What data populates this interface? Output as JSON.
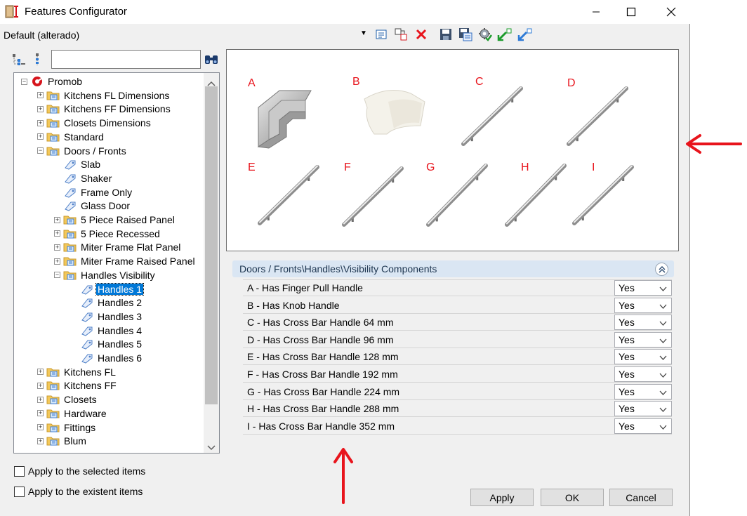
{
  "window": {
    "title": "Features Configurator"
  },
  "profile": {
    "selected": "Default (alterado)"
  },
  "toolbar": {
    "icons": [
      "properties-icon",
      "copy-icon",
      "delete-icon",
      "save-icon",
      "save-as-icon",
      "settings-icon",
      "import-icon",
      "export-icon"
    ]
  },
  "search": {
    "value": "",
    "placeholder": ""
  },
  "tree": {
    "items": [
      {
        "label": "Promob",
        "level": 0,
        "icon": "promob-logo-icon",
        "expander": "minus"
      },
      {
        "label": "Kitchens FL Dimensions",
        "level": 1,
        "icon": "folder-icon",
        "expander": "plus"
      },
      {
        "label": "Kitchens FF Dimensions",
        "level": 1,
        "icon": "folder-icon",
        "expander": "plus"
      },
      {
        "label": "Closets Dimensions",
        "level": 1,
        "icon": "folder-icon",
        "expander": "plus"
      },
      {
        "label": "Standard",
        "level": 1,
        "icon": "folder-icon",
        "expander": "plus"
      },
      {
        "label": "Doors / Fronts",
        "level": 1,
        "icon": "folder-icon",
        "expander": "minus"
      },
      {
        "label": "Slab",
        "level": 2,
        "icon": "tag-icon",
        "expander": "none"
      },
      {
        "label": "Shaker",
        "level": 2,
        "icon": "tag-icon",
        "expander": "none"
      },
      {
        "label": "Frame Only",
        "level": 2,
        "icon": "tag-icon",
        "expander": "none"
      },
      {
        "label": "Glass Door",
        "level": 2,
        "icon": "tag-icon",
        "expander": "none"
      },
      {
        "label": "5 Piece Raised Panel",
        "level": 2,
        "icon": "folder-icon",
        "expander": "plus"
      },
      {
        "label": "5 Piece Recessed",
        "level": 2,
        "icon": "folder-icon",
        "expander": "plus"
      },
      {
        "label": "Miter Frame Flat Panel",
        "level": 2,
        "icon": "folder-icon",
        "expander": "plus"
      },
      {
        "label": "Miter Frame Raised Panel",
        "level": 2,
        "icon": "folder-icon",
        "expander": "plus"
      },
      {
        "label": "Handles Visibility",
        "level": 2,
        "icon": "folder-icon",
        "expander": "minus"
      },
      {
        "label": "Handles 1",
        "level": 3,
        "icon": "tag-icon",
        "expander": "none",
        "selected": true
      },
      {
        "label": "Handles 2",
        "level": 3,
        "icon": "tag-icon",
        "expander": "none"
      },
      {
        "label": "Handles 3",
        "level": 3,
        "icon": "tag-icon",
        "expander": "none"
      },
      {
        "label": "Handles 4",
        "level": 3,
        "icon": "tag-icon",
        "expander": "none"
      },
      {
        "label": "Handles 5",
        "level": 3,
        "icon": "tag-icon",
        "expander": "none"
      },
      {
        "label": "Handles 6",
        "level": 3,
        "icon": "tag-icon",
        "expander": "none"
      },
      {
        "label": "Kitchens FL",
        "level": 1,
        "icon": "folder-icon",
        "expander": "plus"
      },
      {
        "label": "Kitchens FF",
        "level": 1,
        "icon": "folder-icon",
        "expander": "plus"
      },
      {
        "label": "Closets",
        "level": 1,
        "icon": "folder-icon",
        "expander": "plus"
      },
      {
        "label": "Hardware",
        "level": 1,
        "icon": "folder-icon",
        "expander": "plus"
      },
      {
        "label": "Fittings",
        "level": 1,
        "icon": "folder-icon",
        "expander": "plus"
      },
      {
        "label": "Blum",
        "level": 1,
        "icon": "folder-icon",
        "expander": "plus"
      }
    ]
  },
  "options": {
    "apply_selected": "Apply to the selected items",
    "apply_existent": "Apply to the existent items"
  },
  "preview": {
    "letters": [
      "A",
      "B",
      "C",
      "D",
      "E",
      "F",
      "G",
      "H",
      "I"
    ]
  },
  "properties": {
    "title": "Doors / Fronts\\Handles\\Visibility Components",
    "rows": [
      {
        "label": "A -  Has Finger Pull Handle",
        "value": "Yes"
      },
      {
        "label": "B -  Has Knob Handle",
        "value": "Yes"
      },
      {
        "label": "C -  Has Cross Bar Handle 64 mm",
        "value": "Yes"
      },
      {
        "label": "D -  Has Cross Bar Handle 96 mm",
        "value": "Yes"
      },
      {
        "label": "E -  Has Cross Bar Handle 128 mm",
        "value": "Yes"
      },
      {
        "label": "F -  Has Cross Bar Handle 192 mm",
        "value": "Yes"
      },
      {
        "label": "G -  Has Cross Bar Handle 224 mm",
        "value": "Yes"
      },
      {
        "label": "H -  Has Cross Bar Handle 288 mm",
        "value": "Yes"
      },
      {
        "label": "I -  Has Cross Bar Handle 352 mm",
        "value": "Yes"
      }
    ]
  },
  "buttons": {
    "apply": "Apply",
    "ok": "OK",
    "cancel": "Cancel"
  },
  "colors": {
    "annotation_red": "#e8141c",
    "selection_blue": "#0078d7",
    "header_blue": "#dae6f3"
  }
}
